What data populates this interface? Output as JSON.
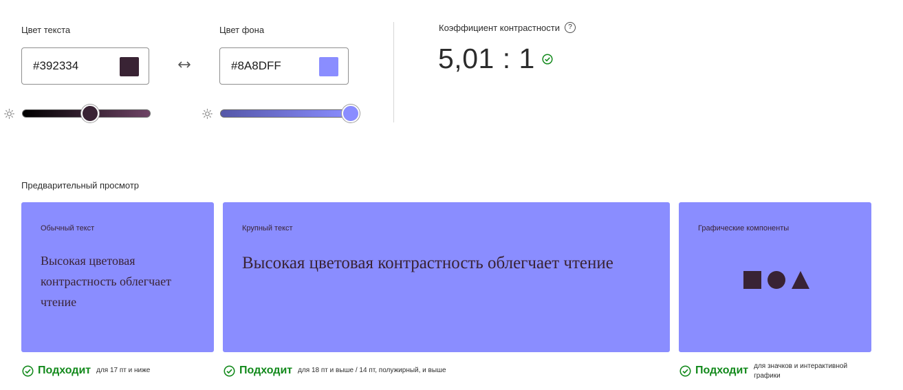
{
  "text_color": {
    "label": "Цвет текста",
    "value": "#392334",
    "swatch": "#392334",
    "slider_fraction": 0.53
  },
  "swap_icon": "swap-arrows-icon",
  "bg_color": {
    "label": "Цвет фона",
    "value": "#8A8DFF",
    "swatch": "#8A8DFF",
    "slider_fraction": 1.0
  },
  "contrast": {
    "label": "Коэффициент контрастности",
    "help_icon": "?",
    "value": "5,01 : 1",
    "status_icon": "check-circle-icon"
  },
  "preview": {
    "heading": "Предварительный просмотр",
    "normal": {
      "title": "Обычный текст",
      "sample": "Высокая цветовая контрастность облегчает чтение",
      "result": "Подходит",
      "note": "для 17 пт и ниже"
    },
    "large": {
      "title": "Крупный текст",
      "sample": "Высокая цветовая контрастность облегчает чтение",
      "result": "Подходит",
      "note": "для 18 пт и выше / 14 пт, полужирный, и выше"
    },
    "graphics": {
      "title": "Графические компоненты",
      "shapes": [
        "square-shape",
        "circle-shape",
        "triangle-shape"
      ],
      "result": "Подходит",
      "note": "для значков и интерактивной графики"
    }
  },
  "colors": {
    "pass_green": "#12891b",
    "preview_bg": "#8A8DFF",
    "preview_fg": "#392334"
  }
}
